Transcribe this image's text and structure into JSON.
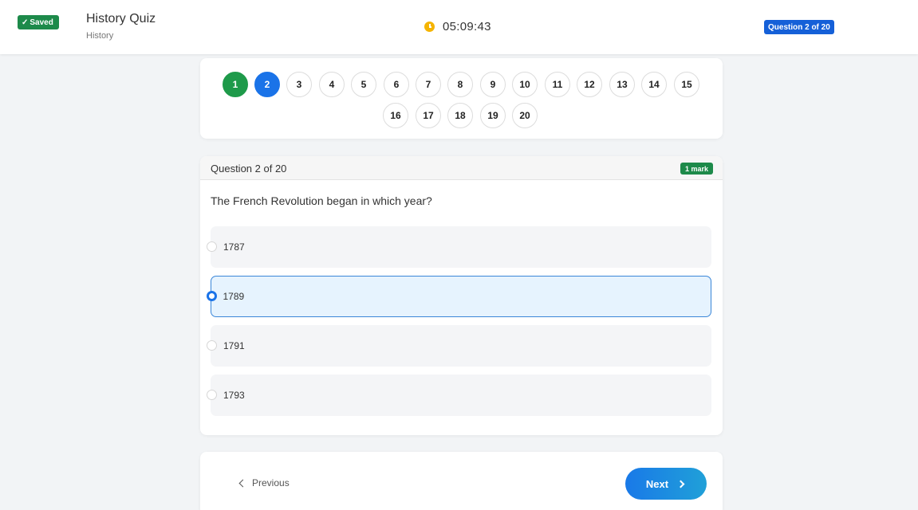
{
  "header": {
    "saved_label": "Saved",
    "title": "History Quiz",
    "subject": "History",
    "timer": "05:09:43",
    "progress_badge": "Question 2 of 20"
  },
  "navigator": {
    "numbers": [
      "1",
      "2",
      "3",
      "4",
      "5",
      "6",
      "7",
      "8",
      "9",
      "10",
      "11",
      "12",
      "13",
      "14",
      "15",
      "16",
      "17",
      "18",
      "19",
      "20"
    ],
    "answered": [
      "1"
    ],
    "current": "2"
  },
  "question": {
    "header_label": "Question 2 of 20",
    "marks": "1 mark",
    "text": "The French Revolution began in which year?",
    "options": [
      {
        "label": "1787",
        "selected": false
      },
      {
        "label": "1789",
        "selected": true
      },
      {
        "label": "1791",
        "selected": false
      },
      {
        "label": "1793",
        "selected": false
      }
    ]
  },
  "footer": {
    "previous_label": "Previous",
    "next_label": "Next"
  },
  "colors": {
    "answered": "#1e9a4a",
    "current": "#1a73e8",
    "saved_badge": "#1d8a4a",
    "timer_icon": "#f5b400",
    "selected_option_bg": "#e6f3fe",
    "next_button": "#1a7fe6"
  }
}
